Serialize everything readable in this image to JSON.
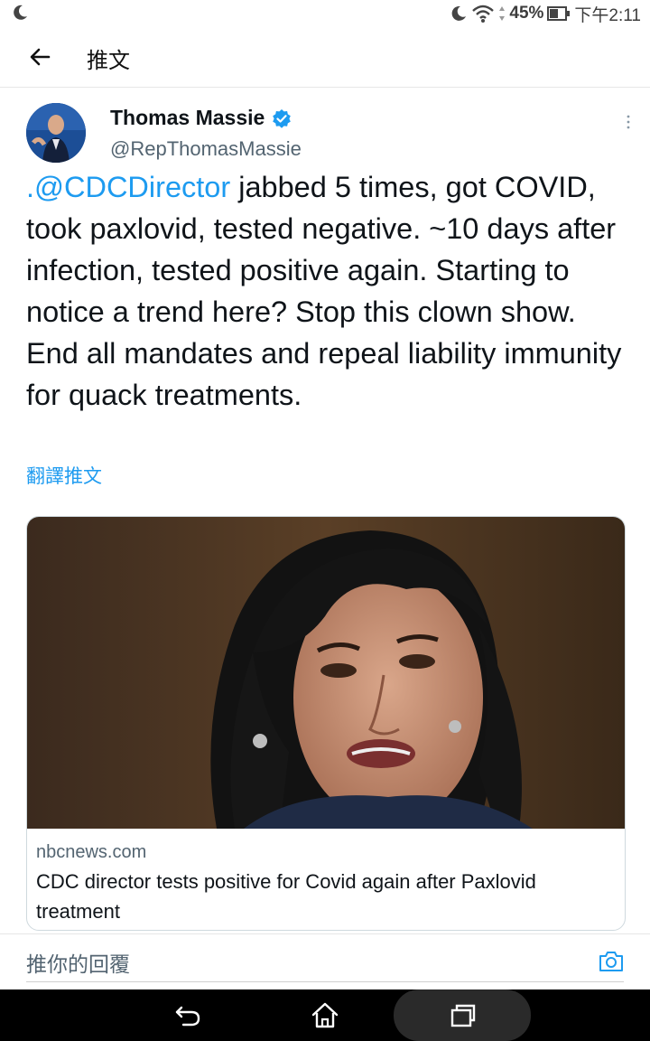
{
  "status_bar": {
    "battery": "45%",
    "time": "下午2:11"
  },
  "header": {
    "title": "推文"
  },
  "tweet": {
    "author_name": "Thomas Massie",
    "author_handle": "@RepThomasMassie",
    "mention": ".@CDCDirector",
    "text": " jabbed 5 times, got COVID, took paxlovid, tested negative.  ~10 days after infection, tested positive again.  Starting to notice a trend here?  Stop this clown show. End all mandates and repeal liability immunity for quack treatments.",
    "translate_label": "翻譯推文"
  },
  "link_card": {
    "domain": "nbcnews.com",
    "title": "CDC director tests positive for Covid again after Paxlovid treatment"
  },
  "reply": {
    "placeholder": "推你的回覆"
  },
  "icons": {
    "back": "back-arrow-icon",
    "verified": "verified-badge-icon",
    "more": "more-vertical-icon",
    "camera": "camera-icon",
    "nav_back": "nav-back-icon",
    "nav_home": "nav-home-icon",
    "nav_recents": "nav-recents-icon"
  },
  "colors": {
    "accent": "#1d9bf0",
    "text": "#0f1419",
    "secondary": "#536471"
  }
}
